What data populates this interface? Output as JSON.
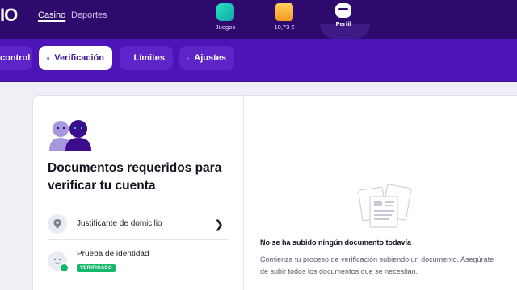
{
  "header": {
    "logo_text": "IO",
    "links": {
      "casino": "Casino",
      "deportes": "Deportes"
    },
    "nav": {
      "games": "Juegos",
      "balance": "10,73 €",
      "profile": "Perfil"
    }
  },
  "subnav": {
    "control": "control",
    "verification": "Verificación",
    "limits": "Límites",
    "settings": "Ajustes"
  },
  "documents": {
    "heading": "Documentos requeridos para verificar tu cuenta",
    "items": [
      {
        "label": "Justificante de domicilio",
        "status": ""
      },
      {
        "label": "Prueba de identidad",
        "status": "VERIFICADO"
      }
    ]
  },
  "empty_state": {
    "title": "No se ha subido ningún documento todavía",
    "description": "Comienza tu proceso de verificación subiendo un documento. Asegúrate de subir todos los documentos que se necesitan."
  },
  "colors": {
    "header_bg": "#2e0a6d",
    "subnav_bg": "#4d14b7",
    "verified": "#14b86a"
  }
}
